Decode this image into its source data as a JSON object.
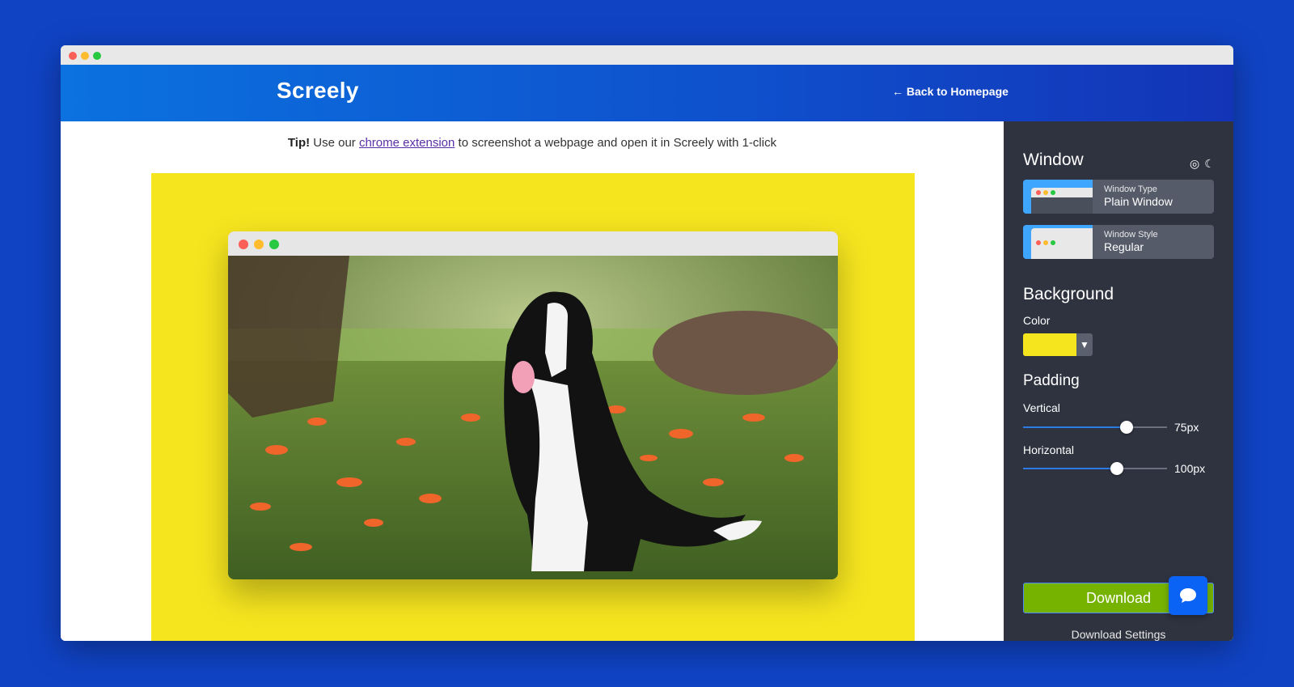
{
  "header": {
    "logo": "Screely",
    "back_link": "← Back to Homepage"
  },
  "tip": {
    "prefix": "Tip!",
    "before_link": " Use our ",
    "link_text": "chrome extension",
    "after_link": " to screenshot a webpage and open it in Screely with 1-click"
  },
  "preview": {
    "background_color": "#f5e51f",
    "image_description_icon": "dog-photo"
  },
  "sidebar": {
    "window_title": "Window",
    "icons": [
      "colors-icon",
      "moon-icon"
    ],
    "window_type": {
      "small": "Window Type",
      "value": "Plain Window"
    },
    "window_style": {
      "small": "Window Style",
      "value": "Regular"
    },
    "background_title": "Background",
    "color_label": "Color",
    "color_value": "#f5e51f",
    "padding_title": "Padding",
    "vertical": {
      "label": "Vertical",
      "value": "75px",
      "level": 0.72
    },
    "horizontal": {
      "label": "Horizontal",
      "value": "100px",
      "level": 0.65
    },
    "download_label": "Download",
    "download_settings": "Download Settings"
  },
  "colors": {
    "page_bg": "#1043c4",
    "accent_green": "#76b300",
    "sidebar_bg": "#2f3340"
  }
}
